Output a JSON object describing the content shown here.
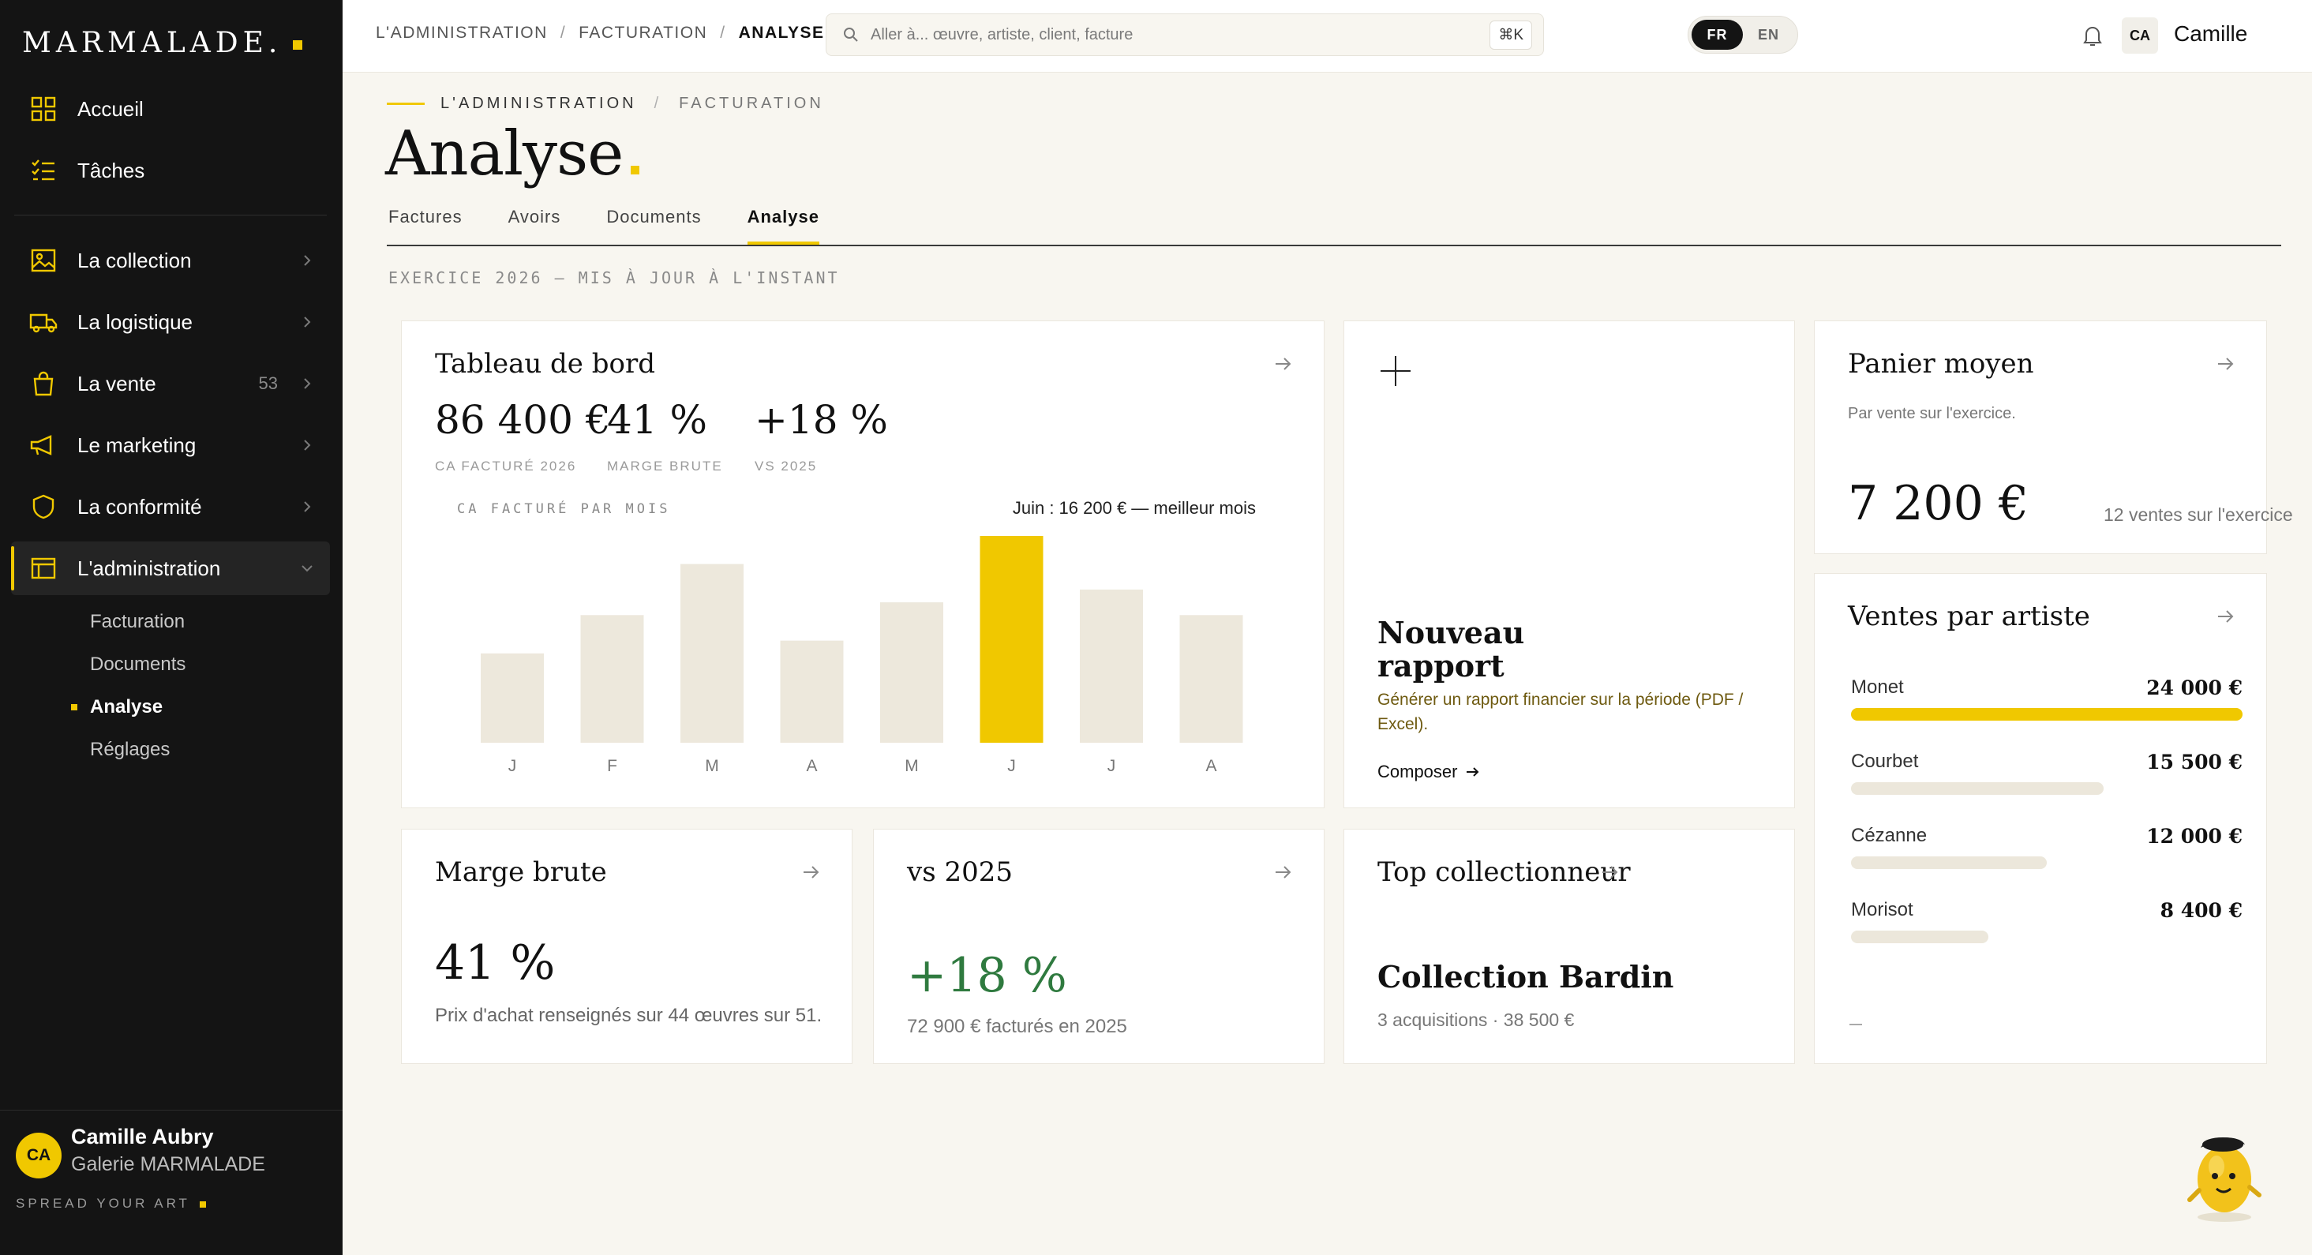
{
  "brand": {
    "name": "MARMALADE."
  },
  "sidebar": {
    "primary": [
      {
        "label": "Accueil",
        "icon": "grid-icon"
      },
      {
        "label": "Tâches",
        "icon": "checklist-icon"
      }
    ],
    "sections": [
      {
        "label": "La collection",
        "icon": "image-icon",
        "count": ""
      },
      {
        "label": "La logistique",
        "icon": "truck-icon",
        "count": ""
      },
      {
        "label": "La vente",
        "icon": "bag-icon",
        "count": "53"
      },
      {
        "label": "Le marketing",
        "icon": "megaphone-icon",
        "count": ""
      },
      {
        "label": "La conformité",
        "icon": "shield-icon",
        "count": ""
      },
      {
        "label": "L'administration",
        "icon": "window-icon",
        "count": ""
      }
    ],
    "subitems": [
      "Facturation",
      "Documents",
      "Analyse",
      "Réglages"
    ],
    "user": {
      "initials": "CA",
      "name": "Camille Aubry",
      "gallery": "Galerie MARMALADE",
      "tagline": "SPREAD YOUR ART"
    }
  },
  "topbar": {
    "breadcrumb": [
      "L'ADMINISTRATION",
      "FACTURATION",
      "ANALYSE"
    ],
    "search_placeholder": "Aller à... œuvre, artiste, client, facture",
    "shortcut": "⌘K",
    "lang": {
      "active": "FR",
      "other": "EN"
    },
    "user_initials": "CA",
    "user_name": "Camille"
  },
  "page": {
    "crumb_first": "L'ADMINISTRATION",
    "crumb_second": "FACTURATION",
    "title": "Analyse",
    "tabs": [
      "Factures",
      "Avoirs",
      "Documents",
      "Analyse"
    ],
    "active_tab": "Analyse",
    "exercise": "EXERCICE 2026 — MIS À JOUR À L'INSTANT"
  },
  "dashboard": {
    "title": "Tableau de bord",
    "kpis": [
      {
        "value": "86 400 €",
        "label": "CA FACTURÉ 2026"
      },
      {
        "value": "41 %",
        "label": "MARGE BRUTE"
      },
      {
        "value": "+18 %",
        "label": "VS 2025"
      }
    ],
    "chart_caption": "CA FACTURÉ PAR MOIS",
    "chart_best": "Juin : 16 200 € — meilleur mois"
  },
  "chart_data": {
    "type": "bar",
    "title": "",
    "xlabel": "",
    "ylabel": "",
    "categories": [
      "J",
      "F",
      "M",
      "A",
      "M",
      "J",
      "J",
      "A"
    ],
    "values": [
      7000,
      10000,
      14000,
      8000,
      11000,
      16200,
      12000,
      10000
    ],
    "ylim": [
      0,
      16200
    ],
    "highlight_index": 5,
    "highlight_color": "#f0c800",
    "bar_color": "#ede8dc",
    "grid": false
  },
  "report": {
    "title": "Nouveau rapport",
    "description": "Générer un rapport financier sur la période (PDF / Excel).",
    "link": "Composer"
  },
  "panier": {
    "title": "Panier moyen",
    "subtitle": "Par vente sur l'exercice.",
    "value": "7 200 €",
    "note": "12 ventes sur l'exercice"
  },
  "artists": {
    "title": "Ventes par artiste",
    "rows": [
      {
        "name": "Monet",
        "value": "24 000 €",
        "amount": 24000
      },
      {
        "name": "Courbet",
        "value": "15 500 €",
        "amount": 15500
      },
      {
        "name": "Cézanne",
        "value": "12 000 €",
        "amount": 12000
      },
      {
        "name": "Morisot",
        "value": "8 400 €",
        "amount": 8400
      }
    ]
  },
  "marge": {
    "title": "Marge brute",
    "value": "41 %",
    "note": "Prix d'achat renseignés sur 44 œuvres sur 51."
  },
  "vs": {
    "title": "vs 2025",
    "value": "+18 %",
    "note": "72 900 € facturés en 2025"
  },
  "collector": {
    "title": "Top collectionneur",
    "name": "Collection Bardin",
    "note": "3 acquisitions · 38 500 €"
  },
  "colors": {
    "accent": "#f0c800",
    "sidebar": "#141414",
    "positive": "#2f7a3f",
    "background": "#f8f6f0"
  }
}
